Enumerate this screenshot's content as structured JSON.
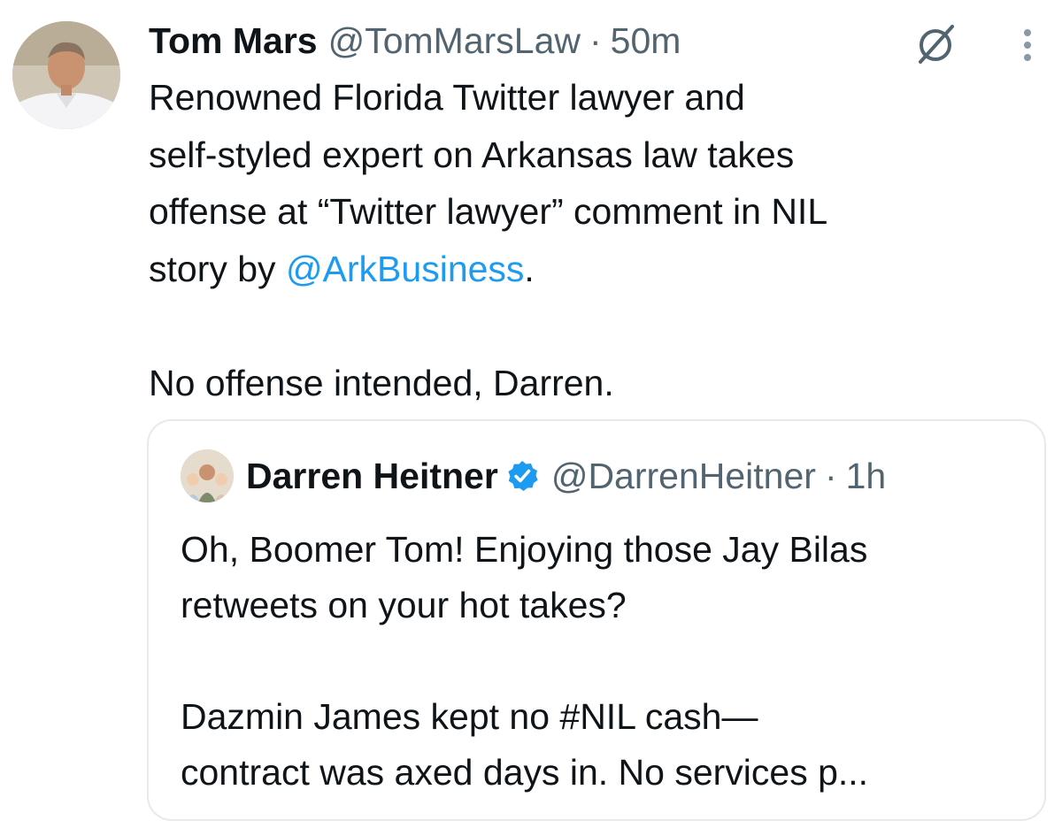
{
  "tweet": {
    "author": {
      "name": "Tom Mars",
      "handle": "@TomMarsLaw",
      "separator": "·",
      "time": "50m"
    },
    "icons": {
      "grok": "slashed-circle-icon",
      "more": "more-vertical-icon"
    },
    "lines": [
      "Renowned Florida Twitter lawyer and",
      "self-styled expert on Arkansas law takes",
      "offense at “Twitter lawyer” comment in NIL",
      "story by "
    ],
    "mention": "@ArkBusiness",
    "mention_suffix": ".",
    "line_after_gap": "No offense intended, Darren."
  },
  "quoted_tweet": {
    "author": {
      "name": "Darren Heitner",
      "handle": "@DarrenHeitner",
      "separator": "·",
      "time": "1h",
      "verified_icon": "verified-badge-icon"
    },
    "lines": [
      "Oh, Boomer Tom! Enjoying those Jay Bilas",
      "retweets on your hot takes?"
    ],
    "lines_after_gap": [
      "Dazmin James kept no #NIL cash—",
      "contract was axed days in. No services p..."
    ]
  },
  "colors": {
    "text": "#0f1419",
    "secondary": "#536471",
    "link": "#1d9bf0",
    "verified": "#1d9bf0",
    "border": "#e7e9ea"
  }
}
